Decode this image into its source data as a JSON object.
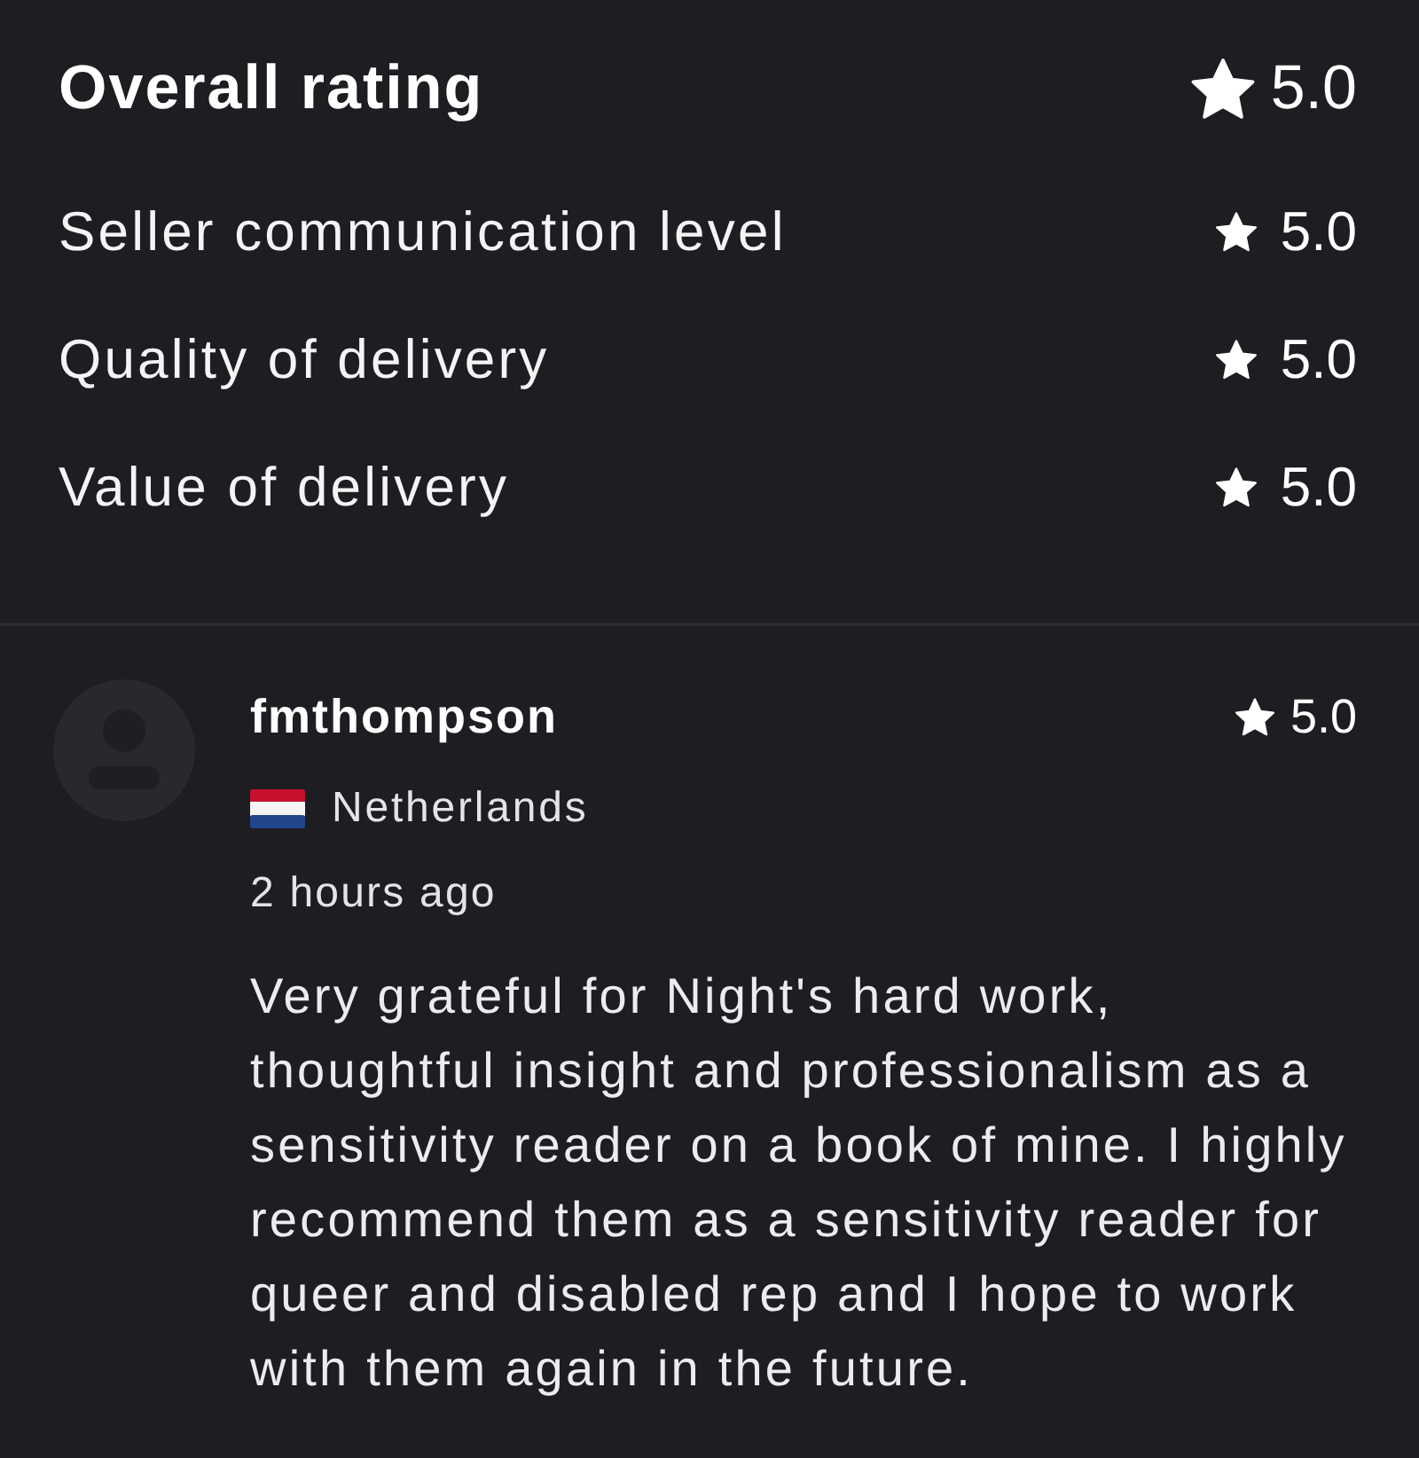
{
  "overall": {
    "label": "Overall rating",
    "rating": "5.0"
  },
  "criteria": [
    {
      "label": "Seller communication level",
      "rating": "5.0"
    },
    {
      "label": "Quality of delivery",
      "rating": "5.0"
    },
    {
      "label": "Value of delivery",
      "rating": "5.0"
    }
  ],
  "review": {
    "username": "fmthompson",
    "rating": "5.0",
    "country": "Netherlands",
    "time": "2 hours ago",
    "text": "Very grateful for Night's hard work, thoughtful insight and professionalism as a sensitivity reader on a book of mine. I highly recommend them as a sensitivity reader for queer and disabled rep and I hope to work with them again in the future."
  }
}
